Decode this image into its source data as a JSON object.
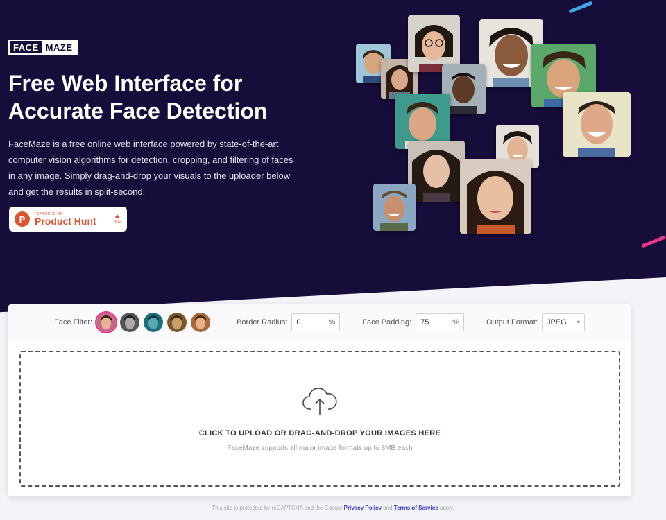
{
  "brand": {
    "part1": "FACE",
    "part2": "MAZE"
  },
  "hero": {
    "title": "Free Web Interface for Accurate Face Detection",
    "description": "FaceMaze is a free online web interface powered by state-of-the-art computer vision algorithms for detection, cropping, and filtering of faces in any image. Simply drag-and-drop your visuals to the uploader below and get the results in split-second."
  },
  "product_hunt": {
    "small": "FEATURED ON",
    "name": "Product Hunt",
    "votes": "552",
    "logo_letter": "P"
  },
  "toolbar": {
    "face_filter_label": "Face Filter:",
    "filters": [
      {
        "name": "color",
        "tone": "#c8668a"
      },
      {
        "name": "grayscale",
        "tone": "#777777"
      },
      {
        "name": "teal",
        "tone": "#2f8f9b"
      },
      {
        "name": "sepia",
        "tone": "#a67b3c"
      },
      {
        "name": "warm",
        "tone": "#c98a55"
      }
    ],
    "border_radius_label": "Border Radius:",
    "border_radius_value": "0",
    "face_padding_label": "Face Padding:",
    "face_padding_value": "75",
    "unit": "%",
    "output_format_label": "Output Format:",
    "output_format_value": "JPEG"
  },
  "upload": {
    "title": "CLICK TO UPLOAD OR DRAG-AND-DROP YOUR IMAGES HERE",
    "subtitle": "FaceMaze supports all major image formats up to 8MB each"
  },
  "footer": {
    "text_before": "This site is protected by reCAPTCHA and the Google",
    "privacy": "Privacy Policy",
    "and": "and",
    "terms": "Terms of Service",
    "apply": "apply."
  },
  "colors": {
    "hero_bg": "#170d3a",
    "accent_pink": "#e6388a",
    "accent_blue": "#3ea8e6",
    "ph_orange": "#da552f"
  }
}
